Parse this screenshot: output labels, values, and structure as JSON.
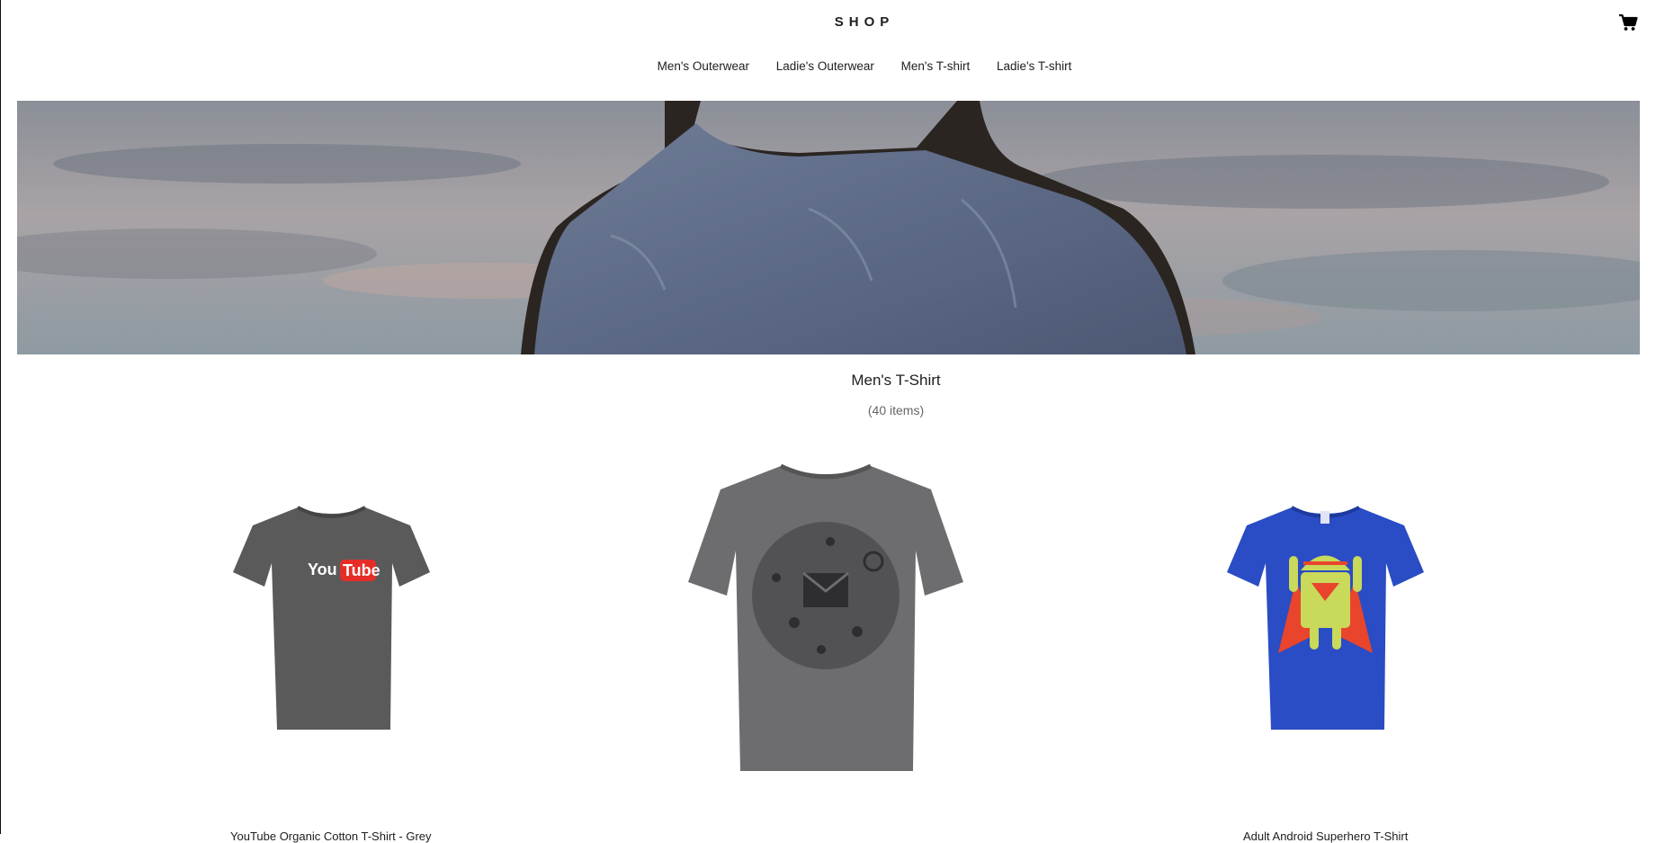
{
  "header": {
    "logo": "SHOP",
    "cart_icon": "shopping-cart-icon"
  },
  "nav": {
    "items": [
      {
        "label": "Men's Outerwear"
      },
      {
        "label": "Ladie's Outerwear"
      },
      {
        "label": "Men's T-shirt"
      },
      {
        "label": "Ladie's T-shirt"
      }
    ]
  },
  "category": {
    "title": "Men's T-Shirt",
    "count": "(40 items)"
  },
  "products": [
    {
      "name": "YouTube Organic Cotton T-Shirt - Grey",
      "shirt_color": "#5a5a5a",
      "print": "YouTube"
    },
    {
      "name": "",
      "shirt_color": "#6d6d6f",
      "print": "icon-collage"
    },
    {
      "name": "Adult Android Superhero T-Shirt",
      "shirt_color": "#2a4cc4",
      "print": "android-superhero"
    }
  ],
  "colors": {
    "youtube_red": "#e52d27",
    "android_green": "#c9d95a",
    "cape_red": "#e8452c"
  }
}
